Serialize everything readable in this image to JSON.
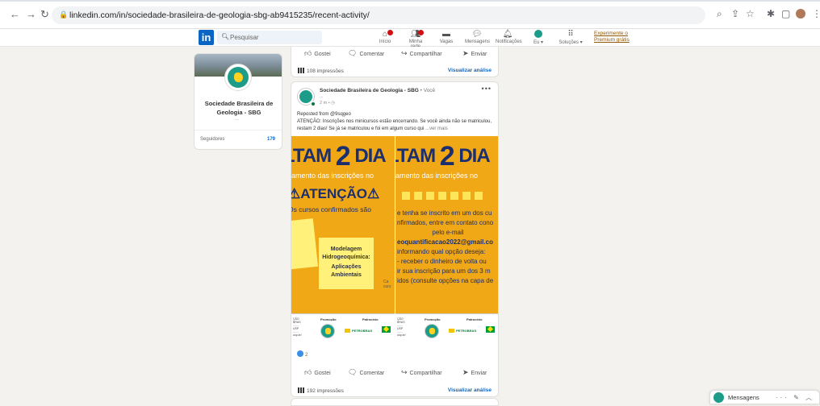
{
  "browser": {
    "url_domain": "linkedin.com",
    "url_path": "/in/sociedade-brasileira-de-geologia-sbg-ab9415235/recent-activity/"
  },
  "header": {
    "logo": "in",
    "search_placeholder": "Pesquisar",
    "nav": [
      {
        "label": "Início",
        "icon": "home-icon"
      },
      {
        "label": "Minha rede",
        "icon": "network-icon"
      },
      {
        "label": "Vagas",
        "icon": "briefcase-icon"
      },
      {
        "label": "Mensagens",
        "icon": "chat-icon"
      },
      {
        "label": "Notificações",
        "icon": "bell-icon"
      },
      {
        "label": "Eu ▾",
        "icon": "avatar-icon"
      },
      {
        "label": "Soluções ▾",
        "icon": "grid-icon"
      }
    ],
    "premium_line1": "Experimente o",
    "premium_line2": "Premium grátis"
  },
  "profile_card": {
    "name": "Sociedade Brasileira de Geologia - SBG",
    "dots": "...",
    "followers_label": "Seguidores",
    "followers_value": "179"
  },
  "post_actions": {
    "like": "Gostei",
    "comment": "Comentar",
    "share": "Compartilhar",
    "send": "Enviar",
    "analyze": "Visualizar análise"
  },
  "post_previous": {
    "impressions": "108 impressões"
  },
  "post": {
    "author": "Sociedade Brasileira de Geologia - SBG",
    "you": " • Você",
    "subtitle": "...",
    "time": "2 m • ◷",
    "more": "•••",
    "repost": "Reposted from @9sqgeo",
    "text": "ATENÇÃO: Inscrições nos minicursos estão encerrando. Se você ainda não se matriculou, restam 2 dias! Se já se matriculou e foi em algum curso qui",
    "see_more": "...ver mais",
    "reactions_count": "2",
    "impressions": "192 impressões"
  },
  "flyer_left": {
    "title_a": "LTAM ",
    "title_2": "2",
    "title_b": " DIA",
    "subtitle": "rramento das inscrições no",
    "atencao": "⚠ATENÇÃO⚠",
    "cursos": "Os cursos confirmados são",
    "sticky1": "s)",
    "sticky2": [
      "Modelagem",
      "Hidrogeoquímica:",
      "Aplicações",
      "Ambientais"
    ],
    "cut": "Ca\ncurs",
    "sp_promo": "Promoção",
    "sp_patro": "Patrocínio",
    "petrobras": "PETROBRAS",
    "small": "ÇÃO\nBRAS\n.......\nUSP\n.......\nusp.br/"
  },
  "flyer_right": {
    "title_a": "LTAM ",
    "title_2": "2",
    "title_b": " DIA",
    "subtitle": "rramento das inscrições no",
    "lines": [
      "e tenha se inscrito em um dos cu",
      "nfirmados, entre em contato cono",
      "pelo e-mail",
      "eoquantificacao2022@gmail.co",
      "informando qual opção deseja:",
      "- receber o dinheiro de volta ou",
      "ir sua inscrição para um dos 3 m",
      "idos (consulte opções na capa de"
    ]
  },
  "messages": {
    "label": "Mensagens",
    "icons": "··· ✎ ︿"
  },
  "colors": {
    "linkedin_blue": "#0a66c2",
    "flyer_orange": "#f0a817",
    "flyer_navy": "#1b2e6e"
  }
}
